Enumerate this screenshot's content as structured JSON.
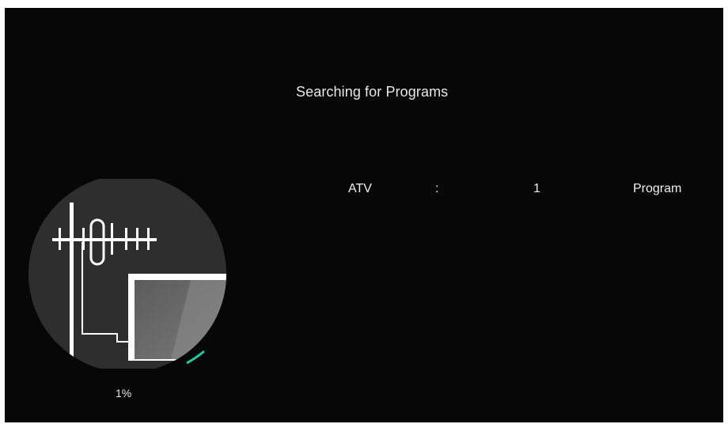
{
  "screen": {
    "title": "Searching for Programs",
    "result": {
      "type": "ATV",
      "separator": ":",
      "count": "1",
      "unit": "Program"
    },
    "progress": {
      "label": "1%",
      "value": 0.01
    },
    "graphic": {
      "icon": "antenna-tv-icon",
      "disc_color": "#2e2e2e",
      "line_color": "#ffffff",
      "screen_color": "#6f6f6f",
      "progress_color": "#28c4a0"
    }
  }
}
